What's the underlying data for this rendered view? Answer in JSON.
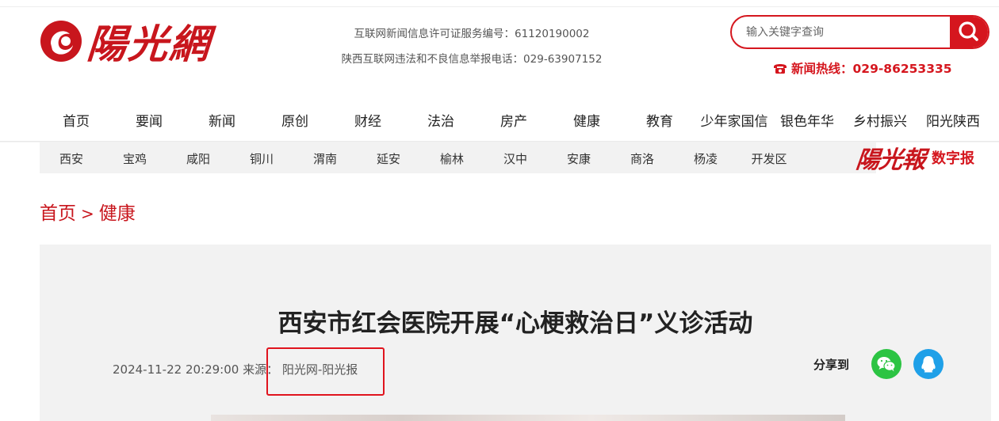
{
  "site": {
    "logo_text": "陽光網",
    "license_line_1": "互联网新闻信息许可证服务编号：61120190002",
    "license_line_2": "陕西互联网违法和不良信息举报电话：029-63907152",
    "hotline": "新闻热线：029-86253335"
  },
  "search": {
    "placeholder": "输入关键字查询",
    "value": "",
    "icon": "search-icon"
  },
  "main_nav": [
    "首页",
    "要闻",
    "新闻",
    "原创",
    "财经",
    "法治",
    "房产",
    "健康",
    "教育",
    "少年家国信",
    "银色年华",
    "乡村振兴",
    "阳光陕西"
  ],
  "sub_nav": [
    "西安",
    "宝鸡",
    "咸阳",
    "铜川",
    "渭南",
    "延安",
    "榆林",
    "汉中",
    "安康",
    "商洛",
    "杨凌",
    "开发区"
  ],
  "digital_paper": {
    "logo_text": "陽光報",
    "label": "数字报"
  },
  "breadcrumb": {
    "home": "首页",
    "separator": ">",
    "current": "健康"
  },
  "article": {
    "title": "西安市红会医院开展“心梗救治日”义诊活动",
    "datetime": "2024-11-22 20:29:00",
    "source_label": "来源：",
    "source": "阳光网-阳光报",
    "share_label": "分享到"
  },
  "colors": {
    "brand_red": "#d5161e",
    "wechat_green": "#2cc443",
    "qq_blue": "#1fa0e8",
    "panel_bg": "#f2f2f2"
  }
}
